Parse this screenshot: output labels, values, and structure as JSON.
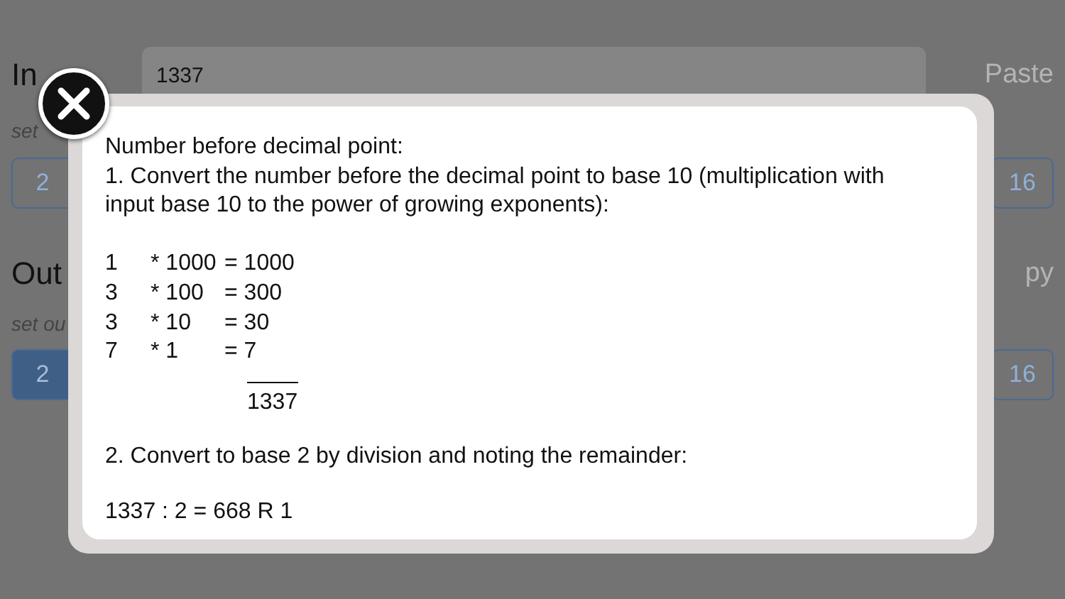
{
  "input": {
    "label": "In",
    "value": "1337",
    "action": "Paste",
    "hint": "set",
    "bases": [
      {
        "label": "2",
        "selected": false
      },
      {
        "label": "16",
        "selected": false
      }
    ]
  },
  "output": {
    "label": "Out",
    "action": "py",
    "hint": "set ou",
    "bases": [
      {
        "label": "2",
        "selected": true
      },
      {
        "label": "16",
        "selected": false
      }
    ]
  },
  "explanation": {
    "intro": "Number before decimal point:",
    "step_1": "1. Convert the number before the decimal point to base 10 (multiplication with input base 10 to the power of growing exponents):",
    "rows": [
      {
        "digit": "1",
        "factor": "* 1000",
        "result": "= 1000"
      },
      {
        "digit": "3",
        "factor": "* 100",
        "result": "= 300"
      },
      {
        "digit": "3",
        "factor": "* 10",
        "result": "= 30"
      },
      {
        "digit": "7",
        "factor": "* 1",
        "result": "= 7"
      }
    ],
    "sum": "1337",
    "step_2": "2. Convert to base 2 by division and noting the remainder:",
    "division": "1337 : 2 = 668 R 1"
  }
}
